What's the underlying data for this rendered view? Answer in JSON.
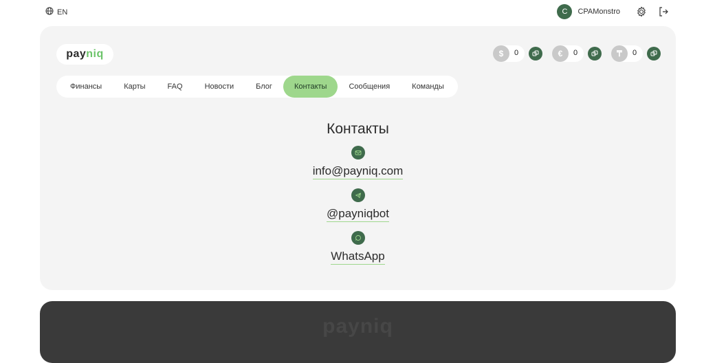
{
  "topbar": {
    "lang": "EN",
    "user": {
      "initial": "C",
      "name": "CPAMonstro"
    }
  },
  "logo": {
    "part1": "pay",
    "part2": "niq"
  },
  "balances": [
    {
      "symbol": "$",
      "value": "0"
    },
    {
      "symbol": "€",
      "value": "0"
    },
    {
      "symbol": "₸",
      "value": "0"
    }
  ],
  "nav": {
    "items": [
      "Финансы",
      "Карты",
      "FAQ",
      "Новости",
      "Блог",
      "Контакты",
      "Сообщения",
      "Команды"
    ],
    "active_index": 5
  },
  "contacts": {
    "title": "Контакты",
    "email": "info@payniq.com",
    "telegram": "@payniqbot",
    "whatsapp": "WhatsApp"
  },
  "footer": {
    "logo": "payniq"
  },
  "colors": {
    "accent": "#9ed78c",
    "dark_green": "#3f6b4c",
    "card_bg": "#f4f4f4",
    "footer_bg": "#3a3a3a"
  }
}
